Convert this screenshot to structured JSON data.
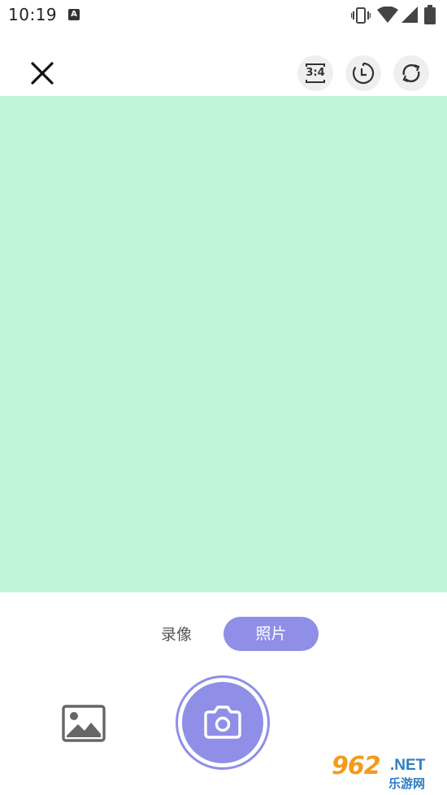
{
  "status_bar": {
    "time": "10:19",
    "notification_badge": "A",
    "icons": [
      "vibrate-icon",
      "wifi-icon",
      "signal-icon",
      "battery-icon"
    ]
  },
  "toolbar": {
    "close_icon": "close-icon",
    "aspect_ratio_label": "3:4",
    "timer_icon": "timer-icon",
    "switch_camera_icon": "switch-camera-icon"
  },
  "preview": {
    "background_color": "#c1f5da"
  },
  "mode_selector": {
    "video_label": "录像",
    "photo_label": "照片",
    "selected": "照片"
  },
  "bottom_controls": {
    "gallery_icon": "image-icon",
    "shutter_icon": "camera-icon"
  },
  "watermark": {
    "logo_number": "962",
    "logo_suffix": ".NET",
    "logo_subtitle": "乐游网"
  },
  "colors": {
    "accent": "#8f8fe8",
    "preview": "#c1f5da"
  }
}
